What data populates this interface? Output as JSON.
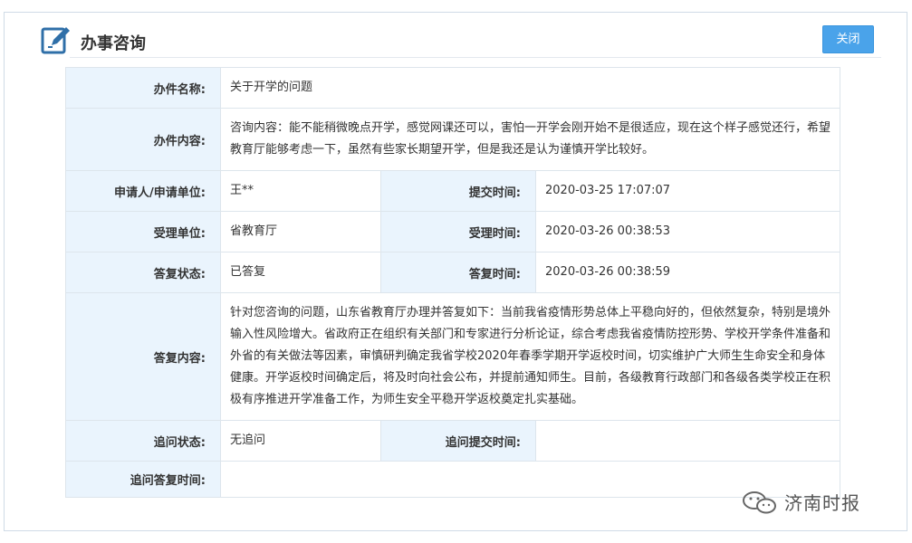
{
  "header": {
    "title": "办事咨询",
    "close_label": "关闭"
  },
  "rows": {
    "name_label": "办件名称:",
    "name_value": "关于开学的问题",
    "content_label": "办件内容:",
    "content_value": "咨询内容：能不能稍微晚点开学，感觉网课还可以，害怕一开学会刚开始不是很适应，现在这个样子感觉还行，希望教育厅能够考虑一下，虽然有些家长期望开学，但是我还是认为谨慎开学比较好。",
    "applicant_label": "申请人/申请单位:",
    "applicant_value": "王**",
    "submit_time_label": "提交时间:",
    "submit_time_value": "2020-03-25 17:07:07",
    "accept_unit_label": "受理单位:",
    "accept_unit_value": "省教育厅",
    "accept_time_label": "受理时间:",
    "accept_time_value": "2020-03-26 00:38:53",
    "reply_status_label": "答复状态:",
    "reply_status_value": "已答复",
    "reply_time_label": "答复时间:",
    "reply_time_value": "2020-03-26 00:38:59",
    "reply_content_label": "答复内容:",
    "reply_content_value": "针对您咨询的问题，山东省教育厅办理并答复如下：当前我省疫情形势总体上平稳向好的，但依然复杂，特别是境外输入性风险增大。省政府正在组织有关部门和专家进行分析论证，综合考虑我省疫情防控形势、学校开学条件准备和外省的有关做法等因素，审慎研判确定我省学校2020年春季学期开学返校时间，切实维护广大师生生命安全和身体健康。开学返校时间确定后，将及时向社会公布，并提前通知师生。目前，各级教育行政部门和各级各类学校正在积极有序推进开学准备工作，为师生安全平稳开学返校奠定扎实基础。",
    "followup_status_label": "追问状态:",
    "followup_status_value": "无追问",
    "followup_submit_label": "追问提交时间:",
    "followup_submit_value": "",
    "followup_reply_label": "追问答复时间:",
    "followup_reply_value": ""
  },
  "watermark": {
    "text": "济南时报",
    "icon": "wechat-icon"
  },
  "colors": {
    "accent": "#4aa3ea",
    "label_bg": "#eaf4fd",
    "border": "#dde5ec",
    "icon": "#2f6fa8"
  },
  "icons": {
    "header": "edit-icon"
  }
}
